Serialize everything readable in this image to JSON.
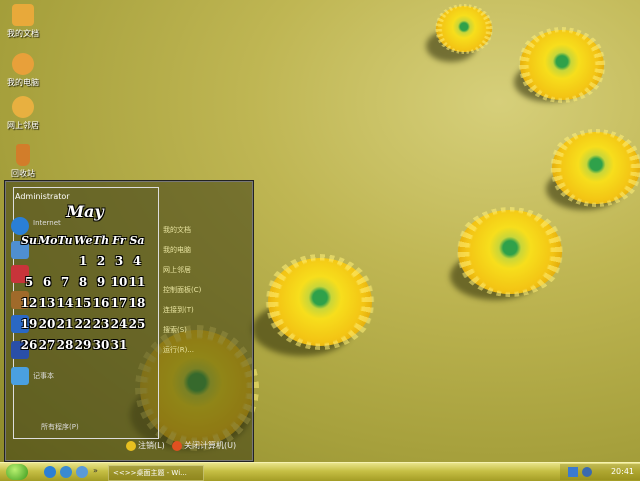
{
  "desktop_icons": [
    {
      "label": "我的文档",
      "icon": "folder-icon",
      "color": "#e8a93a"
    },
    {
      "label": "我的电脑",
      "icon": "computer-icon",
      "color": "#e8a03a"
    },
    {
      "label": "网上邻居",
      "icon": "network-icon",
      "color": "#e8b040"
    },
    {
      "label": "回收站",
      "icon": "recycle-bin-icon",
      "color": "#d27d2a"
    }
  ],
  "start_menu": {
    "username": "Administrator",
    "pinned": [
      {
        "label": "Internet",
        "icon": "internet-explorer-icon",
        "color": "#2a7fd6"
      },
      {
        "label": "",
        "icon": "computer-management-icon",
        "color": "#4f8fd0"
      },
      {
        "label": "",
        "icon": "books-icon",
        "color": "#c8343a"
      },
      {
        "label": "",
        "icon": "paint-brushes-icon",
        "color": "#a06a2a"
      },
      {
        "label": "",
        "icon": "remote-desktop-icon",
        "color": "#2a68c4"
      },
      {
        "label": "",
        "icon": "flag-icon",
        "color": "#2a4fa8"
      },
      {
        "label": "记事本",
        "icon": "notepad-icon",
        "color": "#4aa0e0"
      }
    ],
    "all_programs": "所有程序(P)",
    "right_items": [
      "我的文档",
      "我的电脑",
      "网上邻居",
      "控制面板(C)",
      "连接到(T)",
      "搜索(S)",
      "运行(R)..."
    ],
    "logoff": "注销(L)",
    "shutdown": "关闭计算机(U)"
  },
  "calendar": {
    "month": "May",
    "weekdays": [
      "Su",
      "Mo",
      "Tu",
      "We",
      "Th",
      "Fr",
      "Sa"
    ],
    "weeks": [
      [
        "",
        "",
        "",
        "",
        "",
        "",
        ""
      ],
      [
        "",
        "",
        "",
        "1",
        "2",
        "3",
        "4"
      ],
      [
        "5",
        "6",
        "7",
        "8",
        "9",
        "10",
        "11"
      ],
      [
        "12",
        "13",
        "14",
        "15",
        "16",
        "17",
        "18"
      ],
      [
        "19",
        "20",
        "21",
        "22",
        "23",
        "24",
        "25"
      ],
      [
        "26",
        "27",
        "28",
        "29",
        "30",
        "31",
        ""
      ]
    ],
    "weeks_shown": [
      [
        "",
        "",
        "",
        "1",
        "2",
        "3",
        "4"
      ],
      [
        "5",
        "6",
        "7",
        "8",
        "9",
        "10",
        "11"
      ],
      [
        "12",
        "13",
        "14",
        "15",
        "16",
        "17",
        "18"
      ],
      [
        "19",
        "20",
        "21",
        "22",
        "23",
        "24",
        "25"
      ],
      [
        "26",
        "27",
        "28",
        "29",
        "30",
        "31",
        ""
      ]
    ]
  },
  "taskbar": {
    "task_label": "<<>>桌面主题 - Wi...",
    "clock": "20:41"
  },
  "colors": {
    "accent": "#c6bf44",
    "flower": "#f3c414",
    "flower_center": "#2fa14a"
  }
}
